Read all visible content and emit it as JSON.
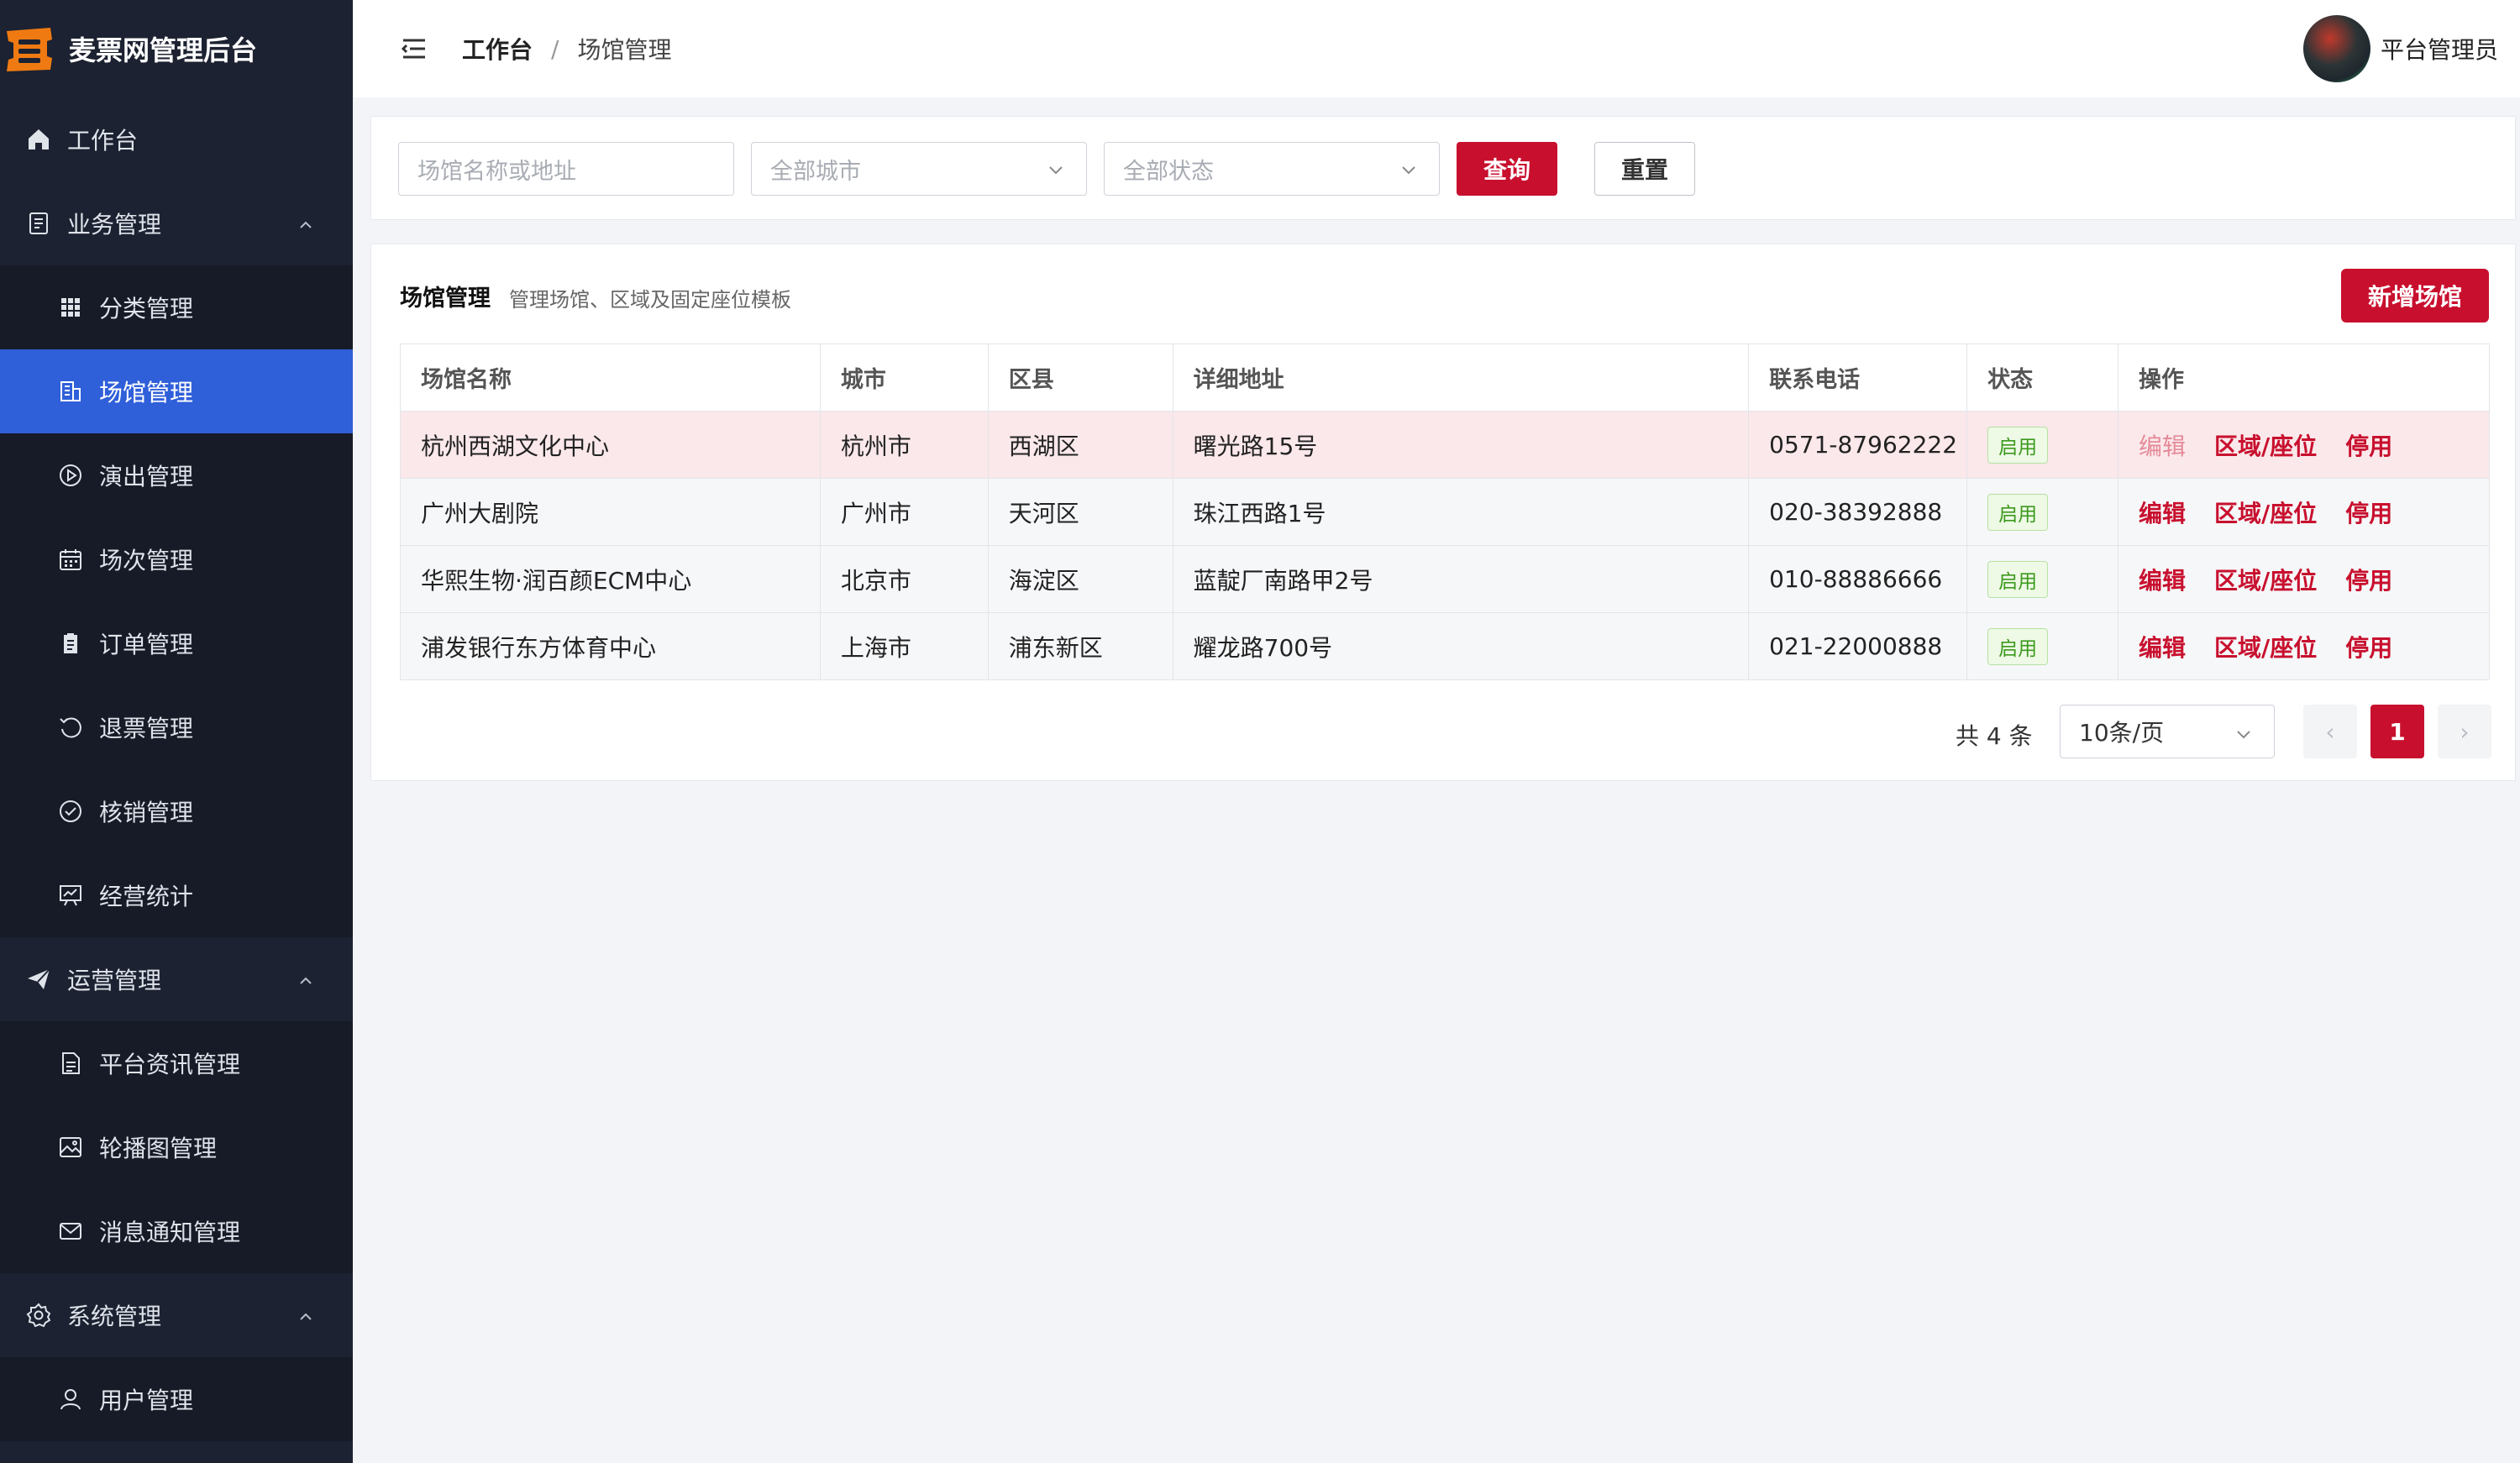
{
  "brand": {
    "title": "麦票网管理后台"
  },
  "sidebar": {
    "items": [
      {
        "key": "workbench",
        "label": "工作台",
        "icon": "home-icon",
        "level": "top"
      },
      {
        "key": "business",
        "label": "业务管理",
        "icon": "document-icon",
        "level": "top",
        "expanded": true
      },
      {
        "key": "category",
        "label": "分类管理",
        "icon": "grid-icon",
        "level": "sub"
      },
      {
        "key": "venue",
        "label": "场馆管理",
        "icon": "building-icon",
        "level": "sub",
        "active": true
      },
      {
        "key": "show",
        "label": "演出管理",
        "icon": "play-circle-icon",
        "level": "sub"
      },
      {
        "key": "session",
        "label": "场次管理",
        "icon": "calendar-icon",
        "level": "sub"
      },
      {
        "key": "order",
        "label": "订单管理",
        "icon": "clipboard-icon",
        "level": "sub"
      },
      {
        "key": "refund",
        "label": "退票管理",
        "icon": "refresh-icon",
        "level": "sub"
      },
      {
        "key": "verify",
        "label": "核销管理",
        "icon": "check-circle-icon",
        "level": "sub"
      },
      {
        "key": "stats",
        "label": "经营统计",
        "icon": "chart-board-icon",
        "level": "sub"
      },
      {
        "key": "ops",
        "label": "运营管理",
        "icon": "paper-plane-icon",
        "level": "top",
        "expanded": true
      },
      {
        "key": "news",
        "label": "平台资讯管理",
        "icon": "file-text-icon",
        "level": "sub"
      },
      {
        "key": "banner",
        "label": "轮播图管理",
        "icon": "image-icon",
        "level": "sub"
      },
      {
        "key": "notice",
        "label": "消息通知管理",
        "icon": "mail-icon",
        "level": "sub"
      },
      {
        "key": "system",
        "label": "系统管理",
        "icon": "gear-icon",
        "level": "top",
        "expanded": true
      },
      {
        "key": "user",
        "label": "用户管理",
        "icon": "user-icon",
        "level": "sub"
      }
    ]
  },
  "header": {
    "breadcrumb_root": "工作台",
    "breadcrumb_sep": "/",
    "breadcrumb_current": "场馆管理",
    "user_name": "平台管理员"
  },
  "filters": {
    "keyword_placeholder": "场馆名称或地址",
    "city_value": "全部城市",
    "status_value": "全部状态",
    "query_label": "查询",
    "reset_label": "重置"
  },
  "panel": {
    "title": "场馆管理",
    "subtitle": "管理场馆、区域及固定座位模板",
    "add_label": "新增场馆"
  },
  "table": {
    "columns": [
      "场馆名称",
      "城市",
      "区县",
      "详细地址",
      "联系电话",
      "状态",
      "操作"
    ],
    "rows": [
      {
        "name": "杭州西湖文化中心",
        "city": "杭州市",
        "district": "西湖区",
        "address": "曙光路15号",
        "phone": "0571-87962222",
        "status": "启用",
        "actions": [
          "编辑",
          "区域/座位",
          "停用"
        ]
      },
      {
        "name": "广州大剧院",
        "city": "广州市",
        "district": "天河区",
        "address": "珠江西路1号",
        "phone": "020-38392888",
        "status": "启用",
        "actions": [
          "编辑",
          "区域/座位",
          "停用"
        ]
      },
      {
        "name": "华熙生物·润百颜ECM中心",
        "city": "北京市",
        "district": "海淀区",
        "address": "蓝靛厂南路甲2号",
        "phone": "010-88886666",
        "status": "启用",
        "actions": [
          "编辑",
          "区域/座位",
          "停用"
        ]
      },
      {
        "name": "浦发银行东方体育中心",
        "city": "上海市",
        "district": "浦东新区",
        "address": "耀龙路700号",
        "phone": "021-22000888",
        "status": "启用",
        "actions": [
          "编辑",
          "区域/座位",
          "停用"
        ]
      }
    ]
  },
  "pagination": {
    "total_text": "共 4 条",
    "page_size": "10条/页",
    "current_page": "1",
    "prev_glyph": "‹",
    "next_glyph": "›"
  },
  "colors": {
    "sidebar_bg": "#1c2231",
    "active_menu": "#2f5fd9",
    "primary": "#c8102e",
    "status_green": "#3d9a1e",
    "highlight_row": "#fbe8eb"
  }
}
